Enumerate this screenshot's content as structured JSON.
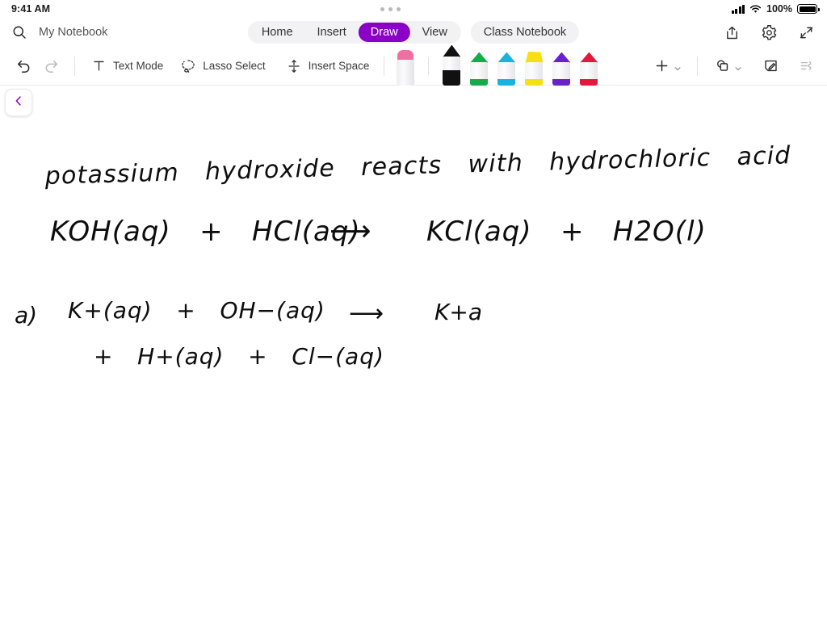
{
  "status_bar": {
    "time": "9:41 AM",
    "battery_percent": "100%",
    "signal_icon": "cellular-signal-icon",
    "wifi_icon": "wifi-icon",
    "battery_icon": "battery-full-icon",
    "multitask_icon": "multitasking-dots-icon"
  },
  "navbar": {
    "search_icon": "search-icon",
    "notebook_title": "My Notebook",
    "tabs": [
      {
        "label": "Home",
        "active": false
      },
      {
        "label": "Insert",
        "active": false
      },
      {
        "label": "Draw",
        "active": true
      },
      {
        "label": "View",
        "active": false
      }
    ],
    "class_notebook_tab": "Class Notebook",
    "actions": [
      {
        "name": "share-icon"
      },
      {
        "name": "settings-gear-icon"
      },
      {
        "name": "collapse-ribbon-icon"
      }
    ],
    "active_tab_color": "#8B00C7"
  },
  "toolbar": {
    "undo_label": "Undo",
    "redo_label": "Redo",
    "undo_icon": "undo-arrow-icon",
    "redo_icon": "redo-arrow-icon",
    "redo_disabled": true,
    "text_mode_label": "Text Mode",
    "text_mode_icon": "text-mode-icon",
    "lasso_label": "Lasso Select",
    "lasso_icon": "lasso-select-icon",
    "insert_space_label": "Insert Space",
    "insert_space_icon": "insert-space-icon",
    "pens": [
      {
        "name": "eraser",
        "color": "#f06fa0",
        "selected": false
      },
      {
        "name": "pen-black",
        "color": "#111111",
        "selected": true
      },
      {
        "name": "pen-green",
        "color": "#17a94a",
        "selected": false
      },
      {
        "name": "pen-cyan",
        "color": "#17b4e0",
        "selected": false
      },
      {
        "name": "highlighter-yellow",
        "color": "#f5e017",
        "selected": false
      },
      {
        "name": "pen-purple",
        "color": "#6b21c8",
        "selected": false
      },
      {
        "name": "pen-red",
        "color": "#e6173c",
        "selected": false
      }
    ],
    "add_pen_icon": "plus-icon",
    "shapes_icon": "shapes-icon",
    "sticky_note_icon": "note-edit-icon",
    "ink_to_text_icon": "ink-to-text-icon",
    "ink_to_text_disabled": true
  },
  "canvas": {
    "collapse_sidebar_icon": "chevron-left-icon",
    "ink_color": "#0d0d0d",
    "handwriting": {
      "line1": "potassium   hydroxide   reacts   with   hydrochloric   acid",
      "line2_left": "KOH(aq)   +   HCl(aq)",
      "line2_arrow": "⟶",
      "line2_right": "KCl(aq)   +   H2O(l)",
      "line3_label": "a)",
      "line3_left": "K+(aq)   +   OH−(aq)",
      "line3_arrow": "⟶",
      "line3_right": "K+a",
      "line4": "+   H+(aq)   +   Cl−(aq)"
    }
  }
}
